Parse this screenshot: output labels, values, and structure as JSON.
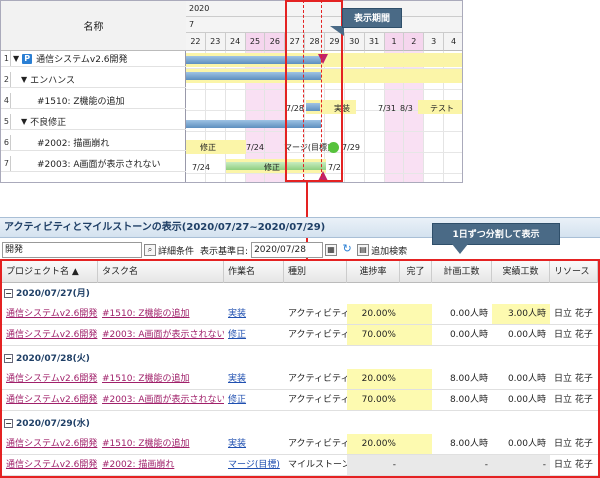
{
  "gantt": {
    "name_header": "名称",
    "year": "2020",
    "month": "7",
    "days": [
      "22",
      "23",
      "24",
      "25",
      "26",
      "27",
      "28",
      "29",
      "30",
      "31",
      "1",
      "2",
      "3",
      "4"
    ],
    "rows": [
      {
        "num": "1",
        "tri": "▼",
        "icon": "P",
        "name": "通信システムv2.6開発",
        "indent": 0
      },
      {
        "num": "2",
        "tri": "▼",
        "icon": "",
        "name": "エンハンス",
        "indent": 1
      },
      {
        "num": "4",
        "tri": "",
        "icon": "",
        "name": "#1510: Z機能の追加",
        "indent": 3
      },
      {
        "num": "5",
        "tri": "▼",
        "icon": "",
        "name": "不良修正",
        "indent": 1
      },
      {
        "num": "6",
        "tri": "",
        "icon": "",
        "name": "#2002: 描画崩れ",
        "indent": 3
      },
      {
        "num": "7",
        "tri": "",
        "icon": "",
        "name": "#2003: A画面が表示されない",
        "indent": 3
      }
    ],
    "labels": {
      "r4_start": "7/28",
      "r4_act1": "実装",
      "r4_end": "7/31",
      "r4_next": "8/3",
      "r4_act2": "テスト",
      "r6_act": "修正",
      "r6_start": "7/24",
      "r6_milestone": "マージ(目標)",
      "r6_date": "7/29",
      "r7_start": "7/24",
      "r7_act": "修正",
      "r7_end": "7/2"
    },
    "period_callout": "表示期間",
    "colors": {
      "period_border": "#e42222",
      "bar_blue": "#5d8fbf",
      "bar_yellow": "#fbf5a8",
      "milestone": "#c2226a",
      "dot_green": "#56c23c"
    }
  },
  "panel": {
    "title": "アクティビティとマイルストーンの表示(2020/07/27~2020/07/29)",
    "daily_callout": "1日ずつ分割して表示",
    "toolbar": {
      "search_value": "開発",
      "search_icon": "search-icon",
      "detail_label": "詳細条件",
      "date_label": "表示基準日:",
      "date_value": "2020/07/28",
      "add_search_label": "追加検索"
    },
    "columns": [
      "プロジェクト名 ▲",
      "タスク名",
      "作業名",
      "種別",
      "進捗率",
      "完了",
      "計画工数",
      "実績工数",
      "リソース"
    ],
    "groups": [
      {
        "date": "2020/07/27(月)",
        "rows": [
          {
            "project": "通信システムv2.6開発",
            "task": "#1510: Z機能の追加",
            "work": "実装",
            "type": "アクティビティ",
            "progress": "20.00%",
            "done": "",
            "plan": "0.00人時",
            "actual": "3.00人時",
            "resource": "日立 花子",
            "milestone": false
          },
          {
            "project": "通信システムv2.6開発",
            "task": "#2003: A画面が表示されない",
            "work": "修正",
            "type": "アクティビティ",
            "progress": "70.00%",
            "done": "",
            "plan": "0.00人時",
            "actual": "0.00人時",
            "resource": "日立 花子",
            "milestone": false
          }
        ]
      },
      {
        "date": "2020/07/28(火)",
        "rows": [
          {
            "project": "通信システムv2.6開発",
            "task": "#1510: Z機能の追加",
            "work": "実装",
            "type": "アクティビティ",
            "progress": "20.00%",
            "done": "",
            "plan": "8.00人時",
            "actual": "0.00人時",
            "resource": "日立 花子",
            "milestone": false
          },
          {
            "project": "通信システムv2.6開発",
            "task": "#2003: A画面が表示されない",
            "work": "修正",
            "type": "アクティビティ",
            "progress": "70.00%",
            "done": "",
            "plan": "8.00人時",
            "actual": "0.00人時",
            "resource": "日立 花子",
            "milestone": false
          }
        ]
      },
      {
        "date": "2020/07/29(水)",
        "rows": [
          {
            "project": "通信システムv2.6開発",
            "task": "#1510: Z機能の追加",
            "work": "実装",
            "type": "アクティビティ",
            "progress": "20.00%",
            "done": "",
            "plan": "8.00人時",
            "actual": "0.00人時",
            "resource": "日立 花子",
            "milestone": false
          },
          {
            "project": "通信システムv2.6開発",
            "task": "#2002: 描画崩れ",
            "work": "マージ(目標)",
            "type": "マイルストーン",
            "progress": "-",
            "done": "",
            "plan": "-",
            "actual": "-",
            "resource": "日立 花子",
            "milestone": true
          }
        ]
      }
    ]
  }
}
